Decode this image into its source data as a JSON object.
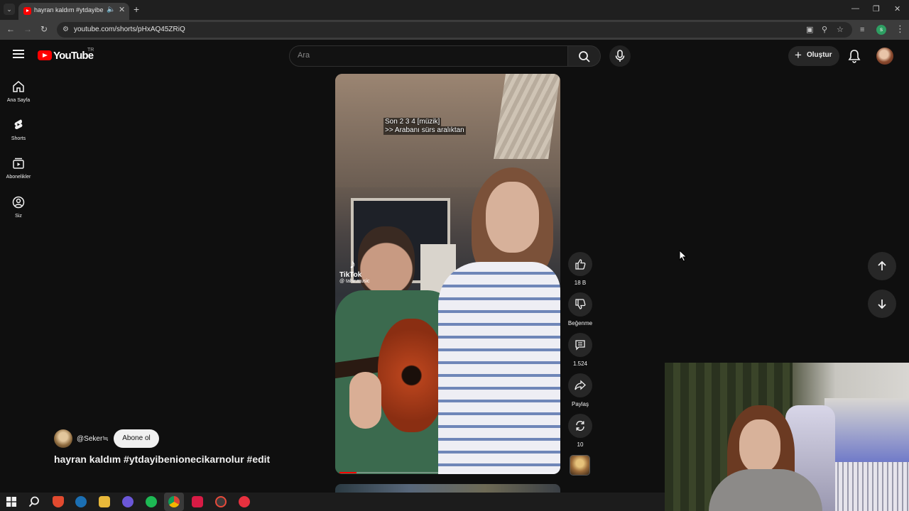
{
  "browser": {
    "tab_title": "hayran kaldım #ytdayibenionecikarnolur #edit - YouTube",
    "url": "youtube.com/shorts/pHxAQ45ZRiQ",
    "profile_initial": "s"
  },
  "masthead": {
    "logo_text": "YouTube",
    "country": "TR",
    "search_placeholder": "Ara",
    "create_label": "Oluştur"
  },
  "sidebar": {
    "items": [
      {
        "label": "Ana Sayfa",
        "icon": "home-icon"
      },
      {
        "label": "Shorts",
        "icon": "shorts-icon"
      },
      {
        "label": "Abonelikler",
        "icon": "subscriptions-icon"
      },
      {
        "label": "Siz",
        "icon": "you-icon"
      }
    ]
  },
  "video": {
    "caption_line1": "Son 2 3 4 [müzik]",
    "caption_line2": ">> Arabanı sürs aralıktan",
    "watermark_name": "TikTok",
    "watermark_handle": "@ tahir.music",
    "progress": 0.08
  },
  "actions": {
    "like_count": "18 B",
    "dislike_label": "Beğenme",
    "comment_count": "1.524",
    "share_label": "Paylaş",
    "remix_count": "10"
  },
  "channel": {
    "name": "@Seker≒",
    "subscribe_label": "Abone ol"
  },
  "title": "hayran kaldım #ytdayibenionecikarnolur #edit",
  "colors": {
    "accent": "#ff0000",
    "background": "#0f0f0f",
    "surface": "#272727"
  }
}
